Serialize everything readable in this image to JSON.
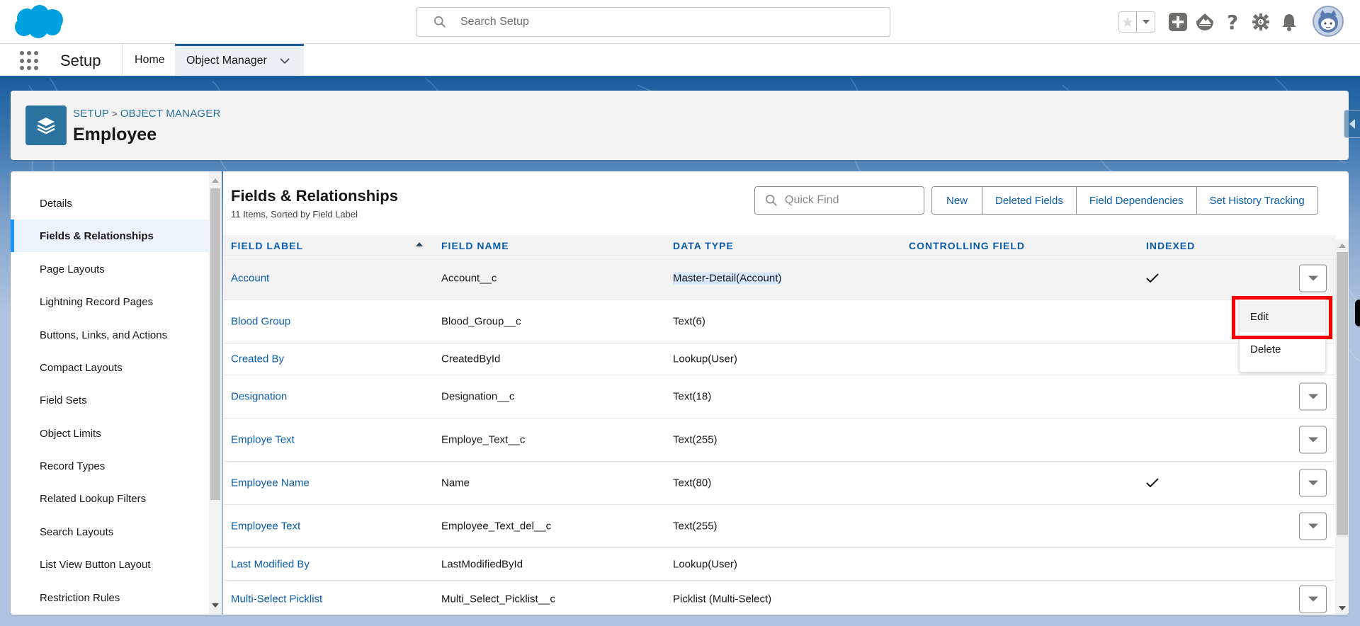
{
  "global_header": {
    "search_placeholder": "Search Setup",
    "icons": [
      "salesforce-cloud-logo",
      "favorites-star-icon",
      "favorites-dropdown-icon",
      "add-icon",
      "trailhead-icon",
      "help-icon",
      "setup-gear-icon",
      "notifications-bell-icon",
      "user-avatar"
    ]
  },
  "nav": {
    "app_name": "Setup",
    "tabs": [
      {
        "label": "Home",
        "active": false
      },
      {
        "label": "Object Manager",
        "active": true
      }
    ]
  },
  "page_header": {
    "breadcrumb": [
      "SETUP",
      "OBJECT MANAGER"
    ],
    "breadcrumb_separator": ">",
    "title": "Employee"
  },
  "sidebar": {
    "items": [
      {
        "label": "Details",
        "active": false
      },
      {
        "label": "Fields & Relationships",
        "active": true
      },
      {
        "label": "Page Layouts",
        "active": false
      },
      {
        "label": "Lightning Record Pages",
        "active": false
      },
      {
        "label": "Buttons, Links, and Actions",
        "active": false
      },
      {
        "label": "Compact Layouts",
        "active": false
      },
      {
        "label": "Field Sets",
        "active": false
      },
      {
        "label": "Object Limits",
        "active": false
      },
      {
        "label": "Record Types",
        "active": false
      },
      {
        "label": "Related Lookup Filters",
        "active": false
      },
      {
        "label": "Search Layouts",
        "active": false
      },
      {
        "label": "List View Button Layout",
        "active": false
      },
      {
        "label": "Restriction Rules",
        "active": false
      }
    ]
  },
  "main": {
    "title": "Fields & Relationships",
    "subtitle": "11 Items, Sorted by Field Label",
    "quick_find_placeholder": "Quick Find",
    "buttons": [
      "New",
      "Deleted Fields",
      "Field Dependencies",
      "Set History Tracking"
    ],
    "columns": [
      "FIELD LABEL",
      "FIELD NAME",
      "DATA TYPE",
      "CONTROLLING FIELD",
      "INDEXED"
    ],
    "sort": {
      "column": "FIELD LABEL",
      "direction": "ascending"
    },
    "rows": [
      {
        "label": "Account",
        "name": "Account__c",
        "type": "Master-Detail(Account)",
        "controlling": "",
        "indexed": true,
        "has_action": true,
        "hover": true
      },
      {
        "label": "Blood Group",
        "name": "Blood_Group__c",
        "type": "Text(6)",
        "controlling": "",
        "indexed": false,
        "has_action": false
      },
      {
        "label": "Created By",
        "name": "CreatedById",
        "type": "Lookup(User)",
        "controlling": "",
        "indexed": false,
        "has_action": false
      },
      {
        "label": "Designation",
        "name": "Designation__c",
        "type": "Text(18)",
        "controlling": "",
        "indexed": false,
        "has_action": true
      },
      {
        "label": "Employe Text",
        "name": "Employe_Text__c",
        "type": "Text(255)",
        "controlling": "",
        "indexed": false,
        "has_action": true
      },
      {
        "label": "Employee Name",
        "name": "Name",
        "type": "Text(80)",
        "controlling": "",
        "indexed": true,
        "has_action": true
      },
      {
        "label": "Employee Text",
        "name": "Employee_Text_del__c",
        "type": "Text(255)",
        "controlling": "",
        "indexed": false,
        "has_action": true
      },
      {
        "label": "Last Modified By",
        "name": "LastModifiedById",
        "type": "Lookup(User)",
        "controlling": "",
        "indexed": false,
        "has_action": false
      },
      {
        "label": "Multi-Select Picklist",
        "name": "Multi_Select_Picklist__c",
        "type": "Picklist (Multi-Select)",
        "controlling": "",
        "indexed": false,
        "has_action": true
      }
    ],
    "row_menu": {
      "items": [
        "Edit",
        "Delete"
      ],
      "highlighted": "Edit"
    }
  },
  "colors": {
    "brand_blue": "#1b5f9e",
    "link_blue": "#0b5cab",
    "object_icon_bg": "#2a739e",
    "active_nav_indicator": "#1b96ff",
    "highlight_box": "#ff0000"
  }
}
